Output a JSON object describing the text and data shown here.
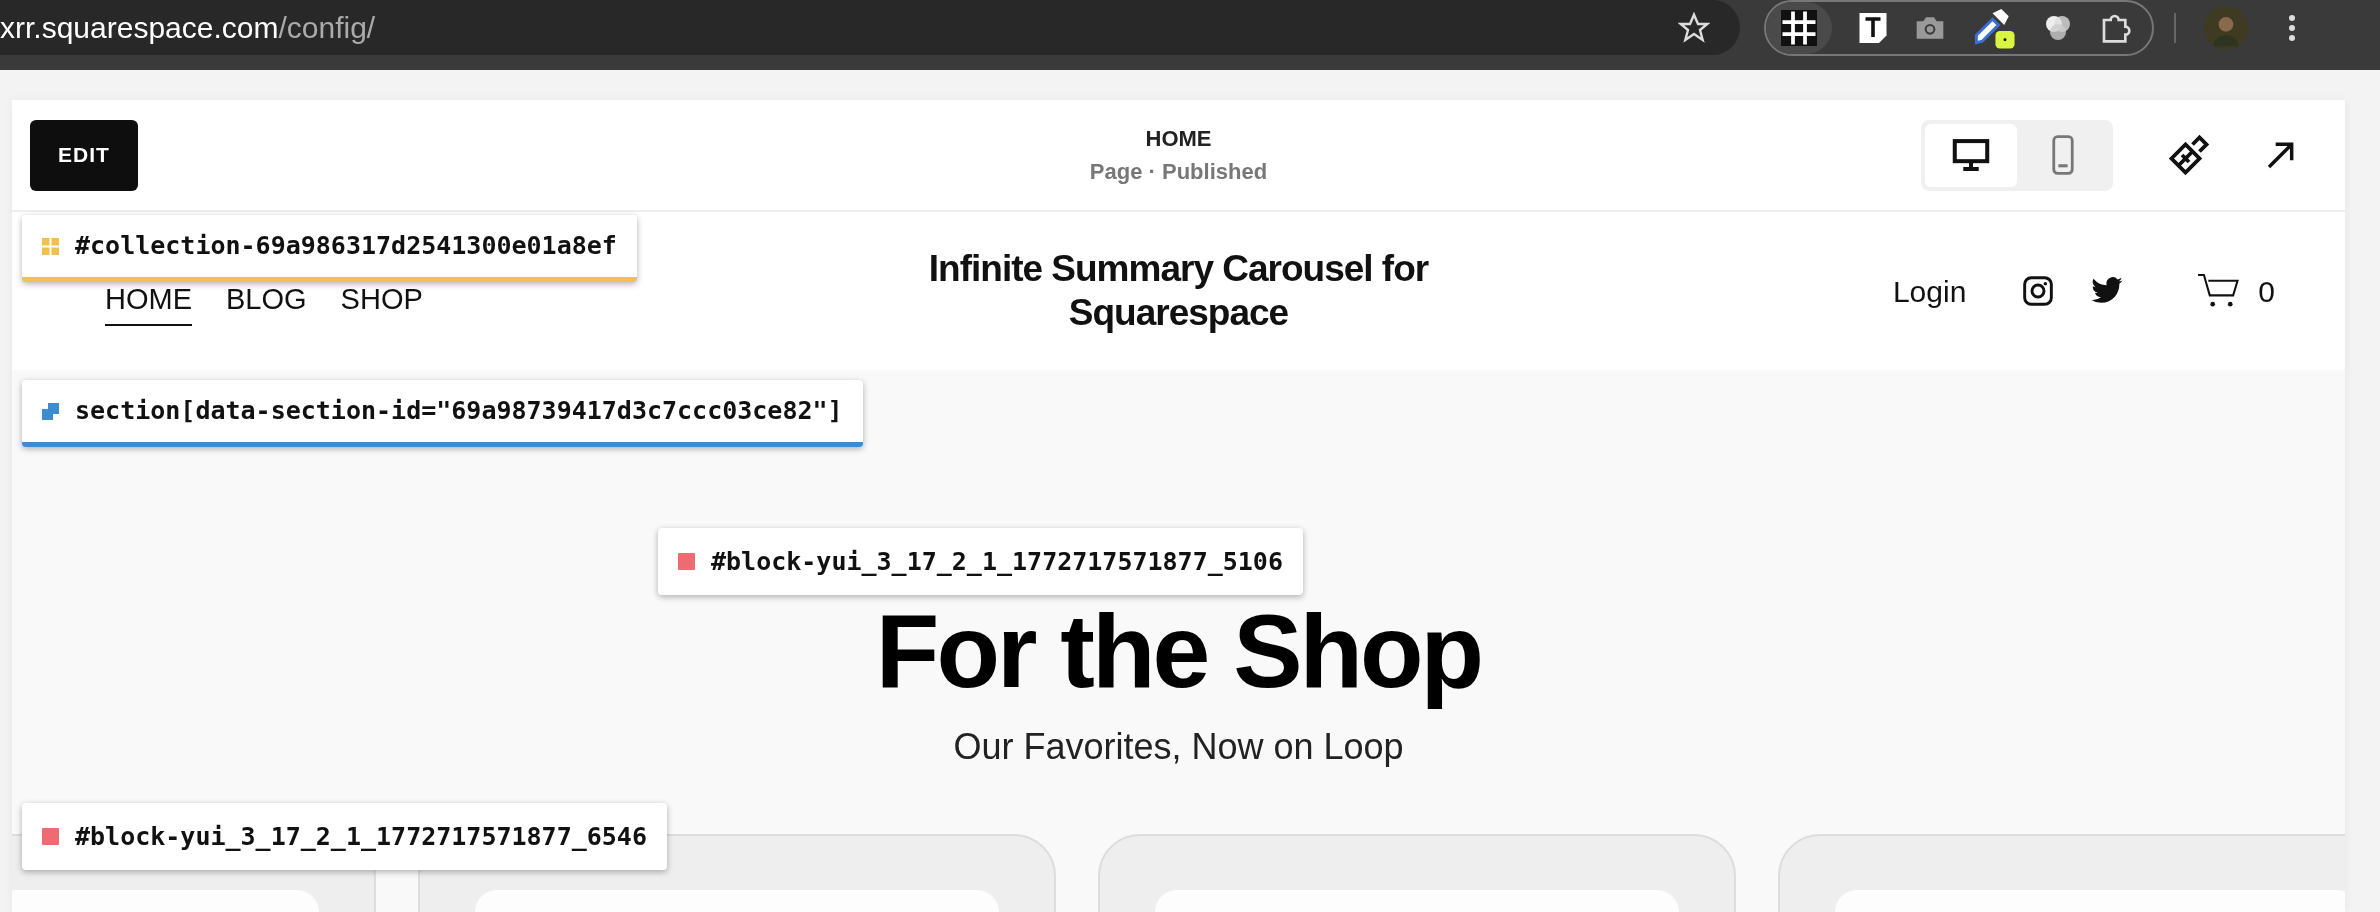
{
  "browser": {
    "url_host": "xrr.squarespace.com",
    "url_path": "/config/"
  },
  "editor": {
    "edit_button": "EDIT",
    "page_title": "HOME",
    "page_status": "Page · Published",
    "devices": [
      {
        "kind": "desktop",
        "selected": true
      },
      {
        "kind": "mobile",
        "selected": false
      }
    ]
  },
  "site_header": {
    "nav": [
      {
        "label": "HOME",
        "selected": true
      },
      {
        "label": "BLOG",
        "selected": false
      },
      {
        "label": "SHOP",
        "selected": false
      }
    ],
    "title": "Infinite Summary Carousel for Squarespace",
    "login": "Login",
    "cart_count": "0"
  },
  "section": {
    "heading": "For the Shop",
    "subheading": "Our Favorites, Now on Loop"
  },
  "overlay_labels": [
    {
      "kind": "collection",
      "text": "#collection-69a986317d2541300e01a8ef",
      "color": "#f2c04f"
    },
    {
      "kind": "section",
      "text": "section[data-section-id=\"69a98739417d3c7ccc03ce82\"]",
      "color": "#3d8ccd"
    },
    {
      "kind": "block",
      "text": "#block-yui_3_17_2_1_1772717571877_5106",
      "color": "#ef6b73"
    },
    {
      "kind": "block",
      "text": "#block-yui_3_17_2_1_1772717571877_6546",
      "color": "#ef6b73"
    }
  ]
}
